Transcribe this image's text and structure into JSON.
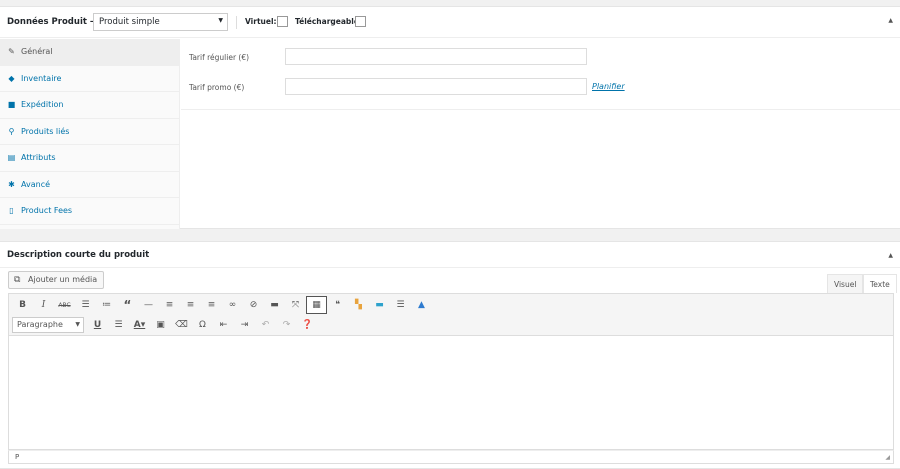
{
  "product_data": {
    "title": "Données Produit —",
    "type_select": "Produit simple",
    "virtual_label": "Virtuel:",
    "downloadable_label": "Téléchargeable:",
    "tabs": [
      {
        "label": "Général",
        "icon": "wrench-icon"
      },
      {
        "label": "Inventaire",
        "icon": "tag-icon"
      },
      {
        "label": "Expédition",
        "icon": "truck-icon"
      },
      {
        "label": "Produits liés",
        "icon": "link-icon"
      },
      {
        "label": "Attributs",
        "icon": "table-icon"
      },
      {
        "label": "Avancé",
        "icon": "gear-icon"
      },
      {
        "label": "Product Fees",
        "icon": "document-icon"
      }
    ],
    "regular_price_label": "Tarif régulier (€)",
    "sale_price_label": "Tarif promo (€)",
    "schedule_link": "Planifier"
  },
  "short_description": {
    "title": "Description courte du produit",
    "add_media": "Ajouter un média",
    "tab_visual": "Visuel",
    "tab_text": "Texte",
    "paragraph_select": "Paragraphe",
    "status_path": "P"
  }
}
